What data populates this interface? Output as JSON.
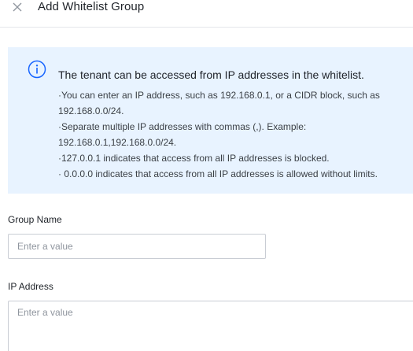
{
  "dialog": {
    "title": "Add Whitelist Group",
    "close_icon": "close-icon"
  },
  "info": {
    "icon": "info-icon",
    "heading": "The tenant can be accessed from IP addresses in the whitelist.",
    "lines": [
      "·You can enter an IP address, such as 192.168.0.1, or a CIDR block, such as",
      "192.168.0.0/24.",
      "·Separate multiple IP addresses with commas (,). Example:",
      "192.168.0.1,192.168.0.0/24.",
      "·127.0.0.1 indicates that access from all IP addresses is blocked.",
      "· 0.0.0.0 indicates that access from all IP addresses is allowed without limits."
    ]
  },
  "form": {
    "group_name": {
      "label": "Group Name",
      "placeholder": "Enter a value",
      "value": ""
    },
    "ip_address": {
      "label": "IP Address",
      "placeholder": "Enter a value",
      "value": ""
    }
  },
  "colors": {
    "info_background": "#e8f3ff",
    "info_icon": "#1664ff",
    "input_border": "#c9cdd4",
    "placeholder": "#8f959e"
  }
}
